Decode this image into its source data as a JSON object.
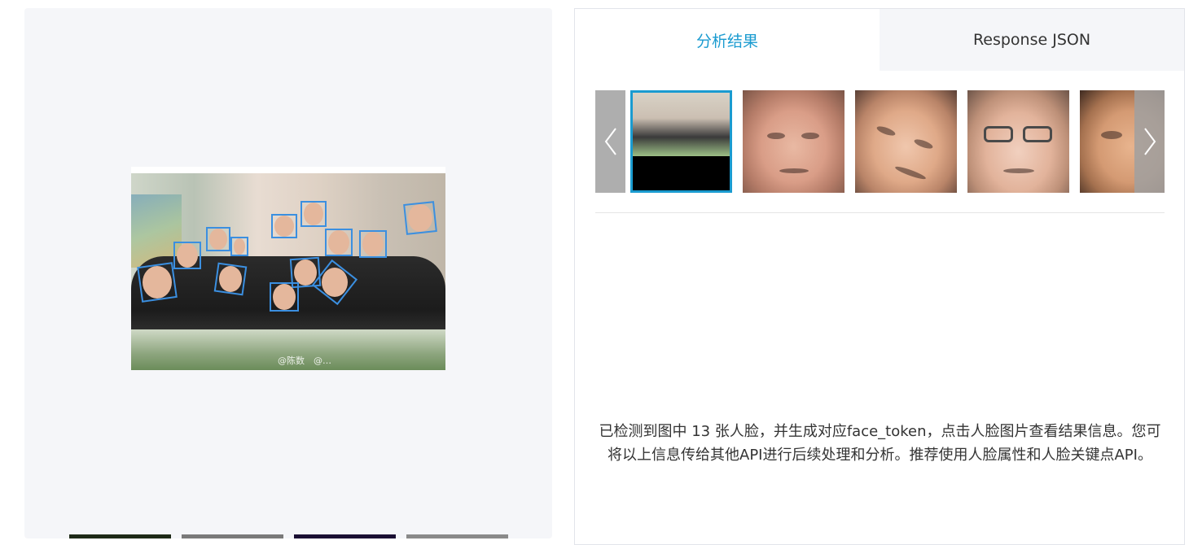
{
  "tabs": {
    "analysis": "分析结果",
    "response_json": "Response JSON"
  },
  "result": {
    "message": "已检测到图中 13 张人脸，并生成对应face_token，点击人脸图片查看结果信息。您可将以上信息传给其他API进行后续处理和分析。推荐使用人脸属性和人脸关键点API。"
  },
  "photo": {
    "watermark": "@陈数　@…",
    "face_count": 13
  },
  "icons": {
    "prev": "chevron-left-icon",
    "next": "chevron-right-icon"
  },
  "colors": {
    "accent": "#1a9bd0",
    "face_box": "#3b8fe0",
    "panel_bg": "#f5f6f9"
  }
}
